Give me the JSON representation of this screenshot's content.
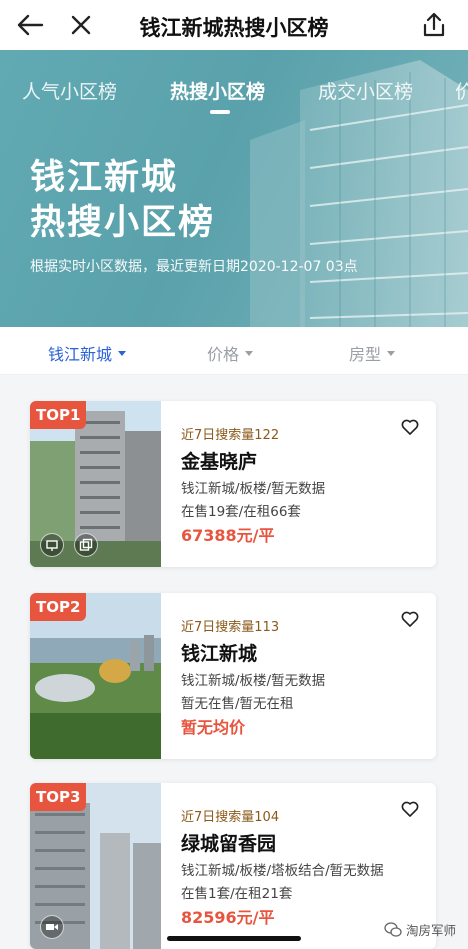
{
  "navbar": {
    "title": "钱江新城热搜小区榜",
    "back_icon": "arrow-left-icon",
    "close_icon": "close-icon",
    "share_icon": "share-upload-icon"
  },
  "hero": {
    "tabs": [
      {
        "label": "人气小区榜"
      },
      {
        "label": "热搜小区榜"
      },
      {
        "label": "成交小区榜"
      },
      {
        "label": "价"
      }
    ],
    "active_tab": "热搜小区榜",
    "title_line1": "钱江新城",
    "title_line2": "热搜小区榜",
    "subtitle": "根据实时小区数据，最近更新日期2020-12-07 03点"
  },
  "filters": {
    "area": "钱江新城",
    "price": "价格",
    "layout": "房型"
  },
  "cards": [
    {
      "rank": "TOP1",
      "search_count": "近7日搜索量122",
      "name": "金基晓庐",
      "desc": "钱江新城/板楼/暂无数据",
      "stock": "在售19套/在租66套",
      "price": "67388元/平"
    },
    {
      "rank": "TOP2",
      "search_count": "近7日搜索量113",
      "name": "钱江新城",
      "desc": "钱江新城/板楼/暂无数据",
      "stock": "暂无在售/暂无在租",
      "price": "暂无均价"
    },
    {
      "rank": "TOP3",
      "search_count": "近7日搜索量104",
      "name": "绿城留香园",
      "desc": "钱江新城/板楼/塔板结合/暂无数据",
      "stock": "在售1套/在租21套",
      "price": "82596元/平"
    }
  ],
  "watermark": "淘房军师",
  "colors": {
    "accent_blue": "#2a62d8",
    "price_red": "#e8553f",
    "search_brown": "#8b5a1a",
    "hero_teal": "#5aa1ab"
  }
}
